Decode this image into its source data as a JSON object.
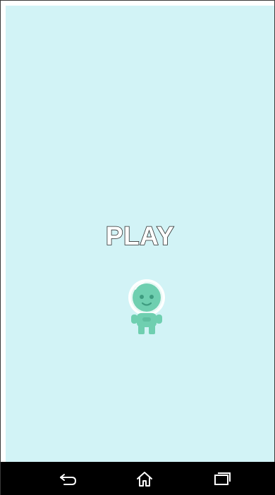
{
  "game": {
    "play_label": "PLAY",
    "character": "astronaut-alien-icon",
    "background_color": "#d2f3f6",
    "character_color": "#6fcfb0"
  },
  "navbar": {
    "background_color": "#000000",
    "buttons": [
      "back-icon",
      "home-icon",
      "recent-apps-icon"
    ]
  }
}
